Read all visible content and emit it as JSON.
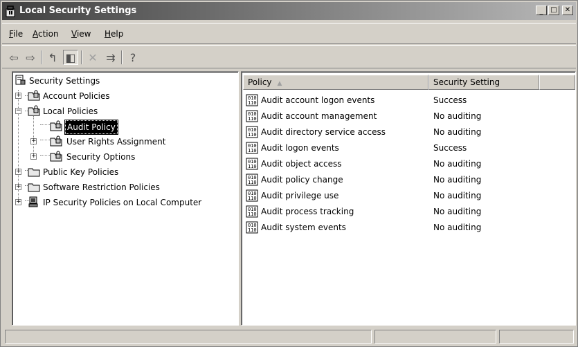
{
  "window": {
    "title": "Local Security Settings",
    "controls": {
      "minimize": "_",
      "maximize": "□",
      "close": "✕"
    }
  },
  "menubar": {
    "items": [
      {
        "label": "File",
        "mnemonic": "F",
        "rest": "ile"
      },
      {
        "label": "Action",
        "mnemonic": "A",
        "rest": "ction"
      },
      {
        "label": "View",
        "mnemonic": "V",
        "rest": "iew"
      },
      {
        "label": "Help",
        "mnemonic": "H",
        "rest": "elp"
      }
    ]
  },
  "toolbar": {
    "buttons": [
      {
        "name": "back-icon",
        "glyph": "⇦"
      },
      {
        "name": "forward-icon",
        "glyph": "⇨"
      },
      {
        "name": "up-one-level-icon",
        "glyph": "↰"
      },
      {
        "name": "show-hide-tree-icon",
        "glyph": "◧"
      },
      {
        "name": "delete-icon",
        "glyph": "✕"
      },
      {
        "name": "export-list-icon",
        "glyph": "⇉"
      },
      {
        "name": "help-icon",
        "glyph": "?"
      }
    ]
  },
  "tree": {
    "root": "Security Settings",
    "items": [
      {
        "label": "Account Policies"
      },
      {
        "label": "Local Policies"
      },
      {
        "label": "Audit Policy",
        "selected": true
      },
      {
        "label": "User Rights Assignment"
      },
      {
        "label": "Security Options"
      },
      {
        "label": "Public Key Policies"
      },
      {
        "label": "Software Restriction Policies"
      },
      {
        "label": "IP Security Policies on Local Computer"
      }
    ]
  },
  "list": {
    "columns": {
      "policy": "Policy",
      "setting": "Security Setting",
      "sort_arrow": "▲"
    },
    "rows": [
      {
        "policy": "Audit account logon events",
        "setting": "Success"
      },
      {
        "policy": "Audit account management",
        "setting": "No auditing"
      },
      {
        "policy": "Audit directory service access",
        "setting": "No auditing"
      },
      {
        "policy": "Audit logon events",
        "setting": "Success"
      },
      {
        "policy": "Audit object access",
        "setting": "No auditing"
      },
      {
        "policy": "Audit policy change",
        "setting": "No auditing"
      },
      {
        "policy": "Audit privilege use",
        "setting": "No auditing"
      },
      {
        "policy": "Audit process tracking",
        "setting": "No auditing"
      },
      {
        "policy": "Audit system events",
        "setting": "No auditing"
      }
    ]
  },
  "colors": {
    "titlebar_start": "#404040",
    "titlebar_end": "#b8b8b8",
    "chrome": "#d4d0c8",
    "selection": "#000000"
  }
}
